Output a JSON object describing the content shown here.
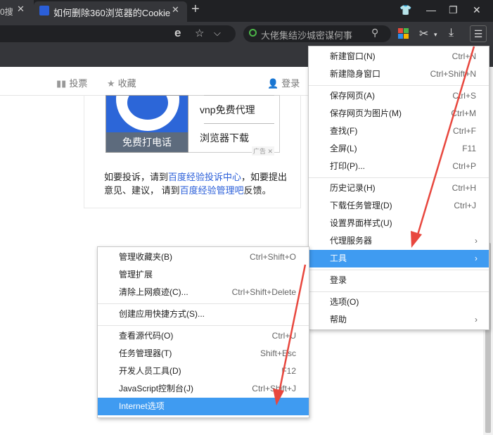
{
  "tabs": {
    "left_tab_title": "0搜",
    "active_tab_title": "如何删除360浏览器的Cookie",
    "close": "✕",
    "new_tab": "+"
  },
  "window_controls": {
    "shirt": "👕",
    "minimize": "—",
    "restore": "❐",
    "close": "✕"
  },
  "toolbar": {
    "ie_icon": "e",
    "star": "☆",
    "chevron": "⌵",
    "search_text": "大佬集结沙城密谋何事",
    "search_icon": "⚲",
    "cut_icon": "✂",
    "download_icon": "⤓",
    "menu_icon": "☰"
  },
  "page": {
    "header": {
      "vote": "投票",
      "favorite": "收藏",
      "login": "登录"
    },
    "ad": {
      "image_caption": "免费打电话",
      "link1": "vnp免费代理",
      "link2": "浏览器下载",
      "tag": "广告"
    },
    "feedback": {
      "line1_a": "如要投诉，请到",
      "line1_link": "百度经验投诉中心",
      "line1_b": "，如要提出",
      "line2_a": "意见、建议， 请到",
      "line2_link": "百度经验管理吧",
      "line2_b": "反馈。"
    }
  },
  "main_menu": {
    "items": [
      {
        "label": "新建窗口(N)",
        "shortcut": "Ctrl+N"
      },
      {
        "label": "新建隐身窗口",
        "shortcut": "Ctrl+Shift+N"
      },
      {
        "label": "保存网页(A)",
        "shortcut": "Ctrl+S"
      },
      {
        "label": "保存网页为图片(M)",
        "shortcut": "Ctrl+M"
      },
      {
        "label": "查找(F)",
        "shortcut": "Ctrl+F"
      },
      {
        "label": "全屏(L)",
        "shortcut": "F11"
      },
      {
        "label": "打印(P)...",
        "shortcut": "Ctrl+P"
      },
      {
        "label": "历史记录(H)",
        "shortcut": "Ctrl+H"
      },
      {
        "label": "下载任务管理(D)",
        "shortcut": "Ctrl+J"
      },
      {
        "label": "设置界面样式(U)",
        "shortcut": ""
      },
      {
        "label": "代理服务器",
        "shortcut": ""
      },
      {
        "label": "工具",
        "shortcut": ""
      },
      {
        "label": "登录",
        "shortcut": ""
      },
      {
        "label": "选项(O)",
        "shortcut": ""
      },
      {
        "label": "帮助",
        "shortcut": ""
      }
    ],
    "arrow": "›"
  },
  "tools_submenu": {
    "items": [
      {
        "label": "管理收藏夹(B)",
        "shortcut": "Ctrl+Shift+O"
      },
      {
        "label": "管理扩展",
        "shortcut": ""
      },
      {
        "label": "清除上网痕迹(C)...",
        "shortcut": "Ctrl+Shift+Delete"
      },
      {
        "label": "创建应用快捷方式(S)...",
        "shortcut": ""
      },
      {
        "label": "查看源代码(O)",
        "shortcut": "Ctrl+U"
      },
      {
        "label": "任务管理器(T)",
        "shortcut": "Shift+Esc"
      },
      {
        "label": "开发人员工具(D)",
        "shortcut": "F12"
      },
      {
        "label": "JavaScript控制台(J)",
        "shortcut": "Ctrl+Shift+J"
      },
      {
        "label": "Internet选项",
        "shortcut": ""
      }
    ]
  },
  "colors": {
    "highlight": "#3f9bf1",
    "arrow": "#e8473e",
    "dark_chrome": "#35363a"
  }
}
